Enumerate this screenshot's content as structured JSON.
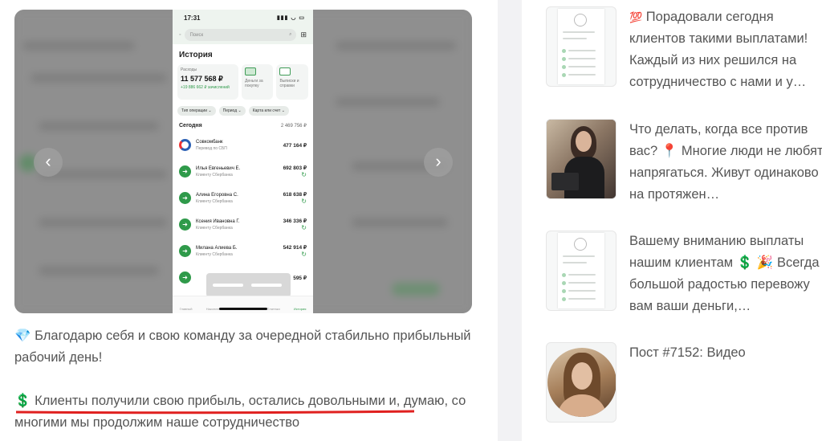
{
  "phone_screenshot": {
    "time": "17:31",
    "search_placeholder": "Поиск",
    "title": "История",
    "card_expenses_label": "Расходы",
    "card_expenses_amount": "11 577 568 ₽",
    "card_income_note": "+19 886 662 ₽ зачислений",
    "card_cashback_label": "Деньги за покупку",
    "card_statements_label": "Выписки и справки",
    "filters": [
      "Тип операции ⌄",
      "Период ⌄",
      "Карта или счет ⌄"
    ],
    "section_label": "Сегодня",
    "section_total": "2 469 756 ₽",
    "transactions": [
      {
        "name": "Совкомбанк",
        "sub": "Перевод по СБП",
        "amount": "477 164 ₽"
      },
      {
        "name": "Илья Евгеньевич Е.",
        "sub": "Клиенту Сбербанка",
        "amount": "692 803 ₽"
      },
      {
        "name": "Алина Егоровна С.",
        "sub": "Клиенту Сбербанка",
        "amount": "618 638 ₽"
      },
      {
        "name": "Ксения Ивановна Г.",
        "sub": "Клиенту Сбербанка",
        "amount": "346 336 ₽"
      },
      {
        "name": "Милана Алиева Б.",
        "sub": "Клиенту Сбербанка",
        "amount": "542 914 ₽"
      },
      {
        "name": "",
        "sub": "",
        "amount": "595 ₽"
      }
    ],
    "tabs": [
      "Главный",
      "Накопления",
      "Ассистент",
      "Платежи",
      "История"
    ]
  },
  "post": {
    "paragraph_1": "Благодарю себя и свою команду за очередной стабильно прибыльный рабочий день!",
    "paragraph_2": "Клиенты получили свою прибыль, остались довольными и, думаю, со многими мы продолжим наше сотрудничество",
    "icons": {
      "paragraph_1": "gem-emoji-icon",
      "paragraph_2": "dollar-emoji-icon"
    },
    "underline_color": "#e0201f"
  },
  "related_posts": [
    {
      "text": "Порадовали сегодня клиентов такими выплатами! Каждый из них решился на сотрудничество с нами и у…",
      "emoji": "💯"
    },
    {
      "text": "Что делать, когда все против вас? 📍 Многие люди не любят напрягаться. Живут одинаково на протяжен…"
    },
    {
      "text_1": "Вашему вниманию выплаты нашим клиентам",
      "emoji_1": "💲",
      "emoji_2": "🎉",
      "text_2": "Всегда с большой радостью перевожу вам ваши деньги,…"
    },
    {
      "text": "Пост #7152: Видео"
    }
  ],
  "colors": {
    "accent_green": "#2f9a4a",
    "text": "#555555",
    "divider": "#f2f2f4"
  }
}
